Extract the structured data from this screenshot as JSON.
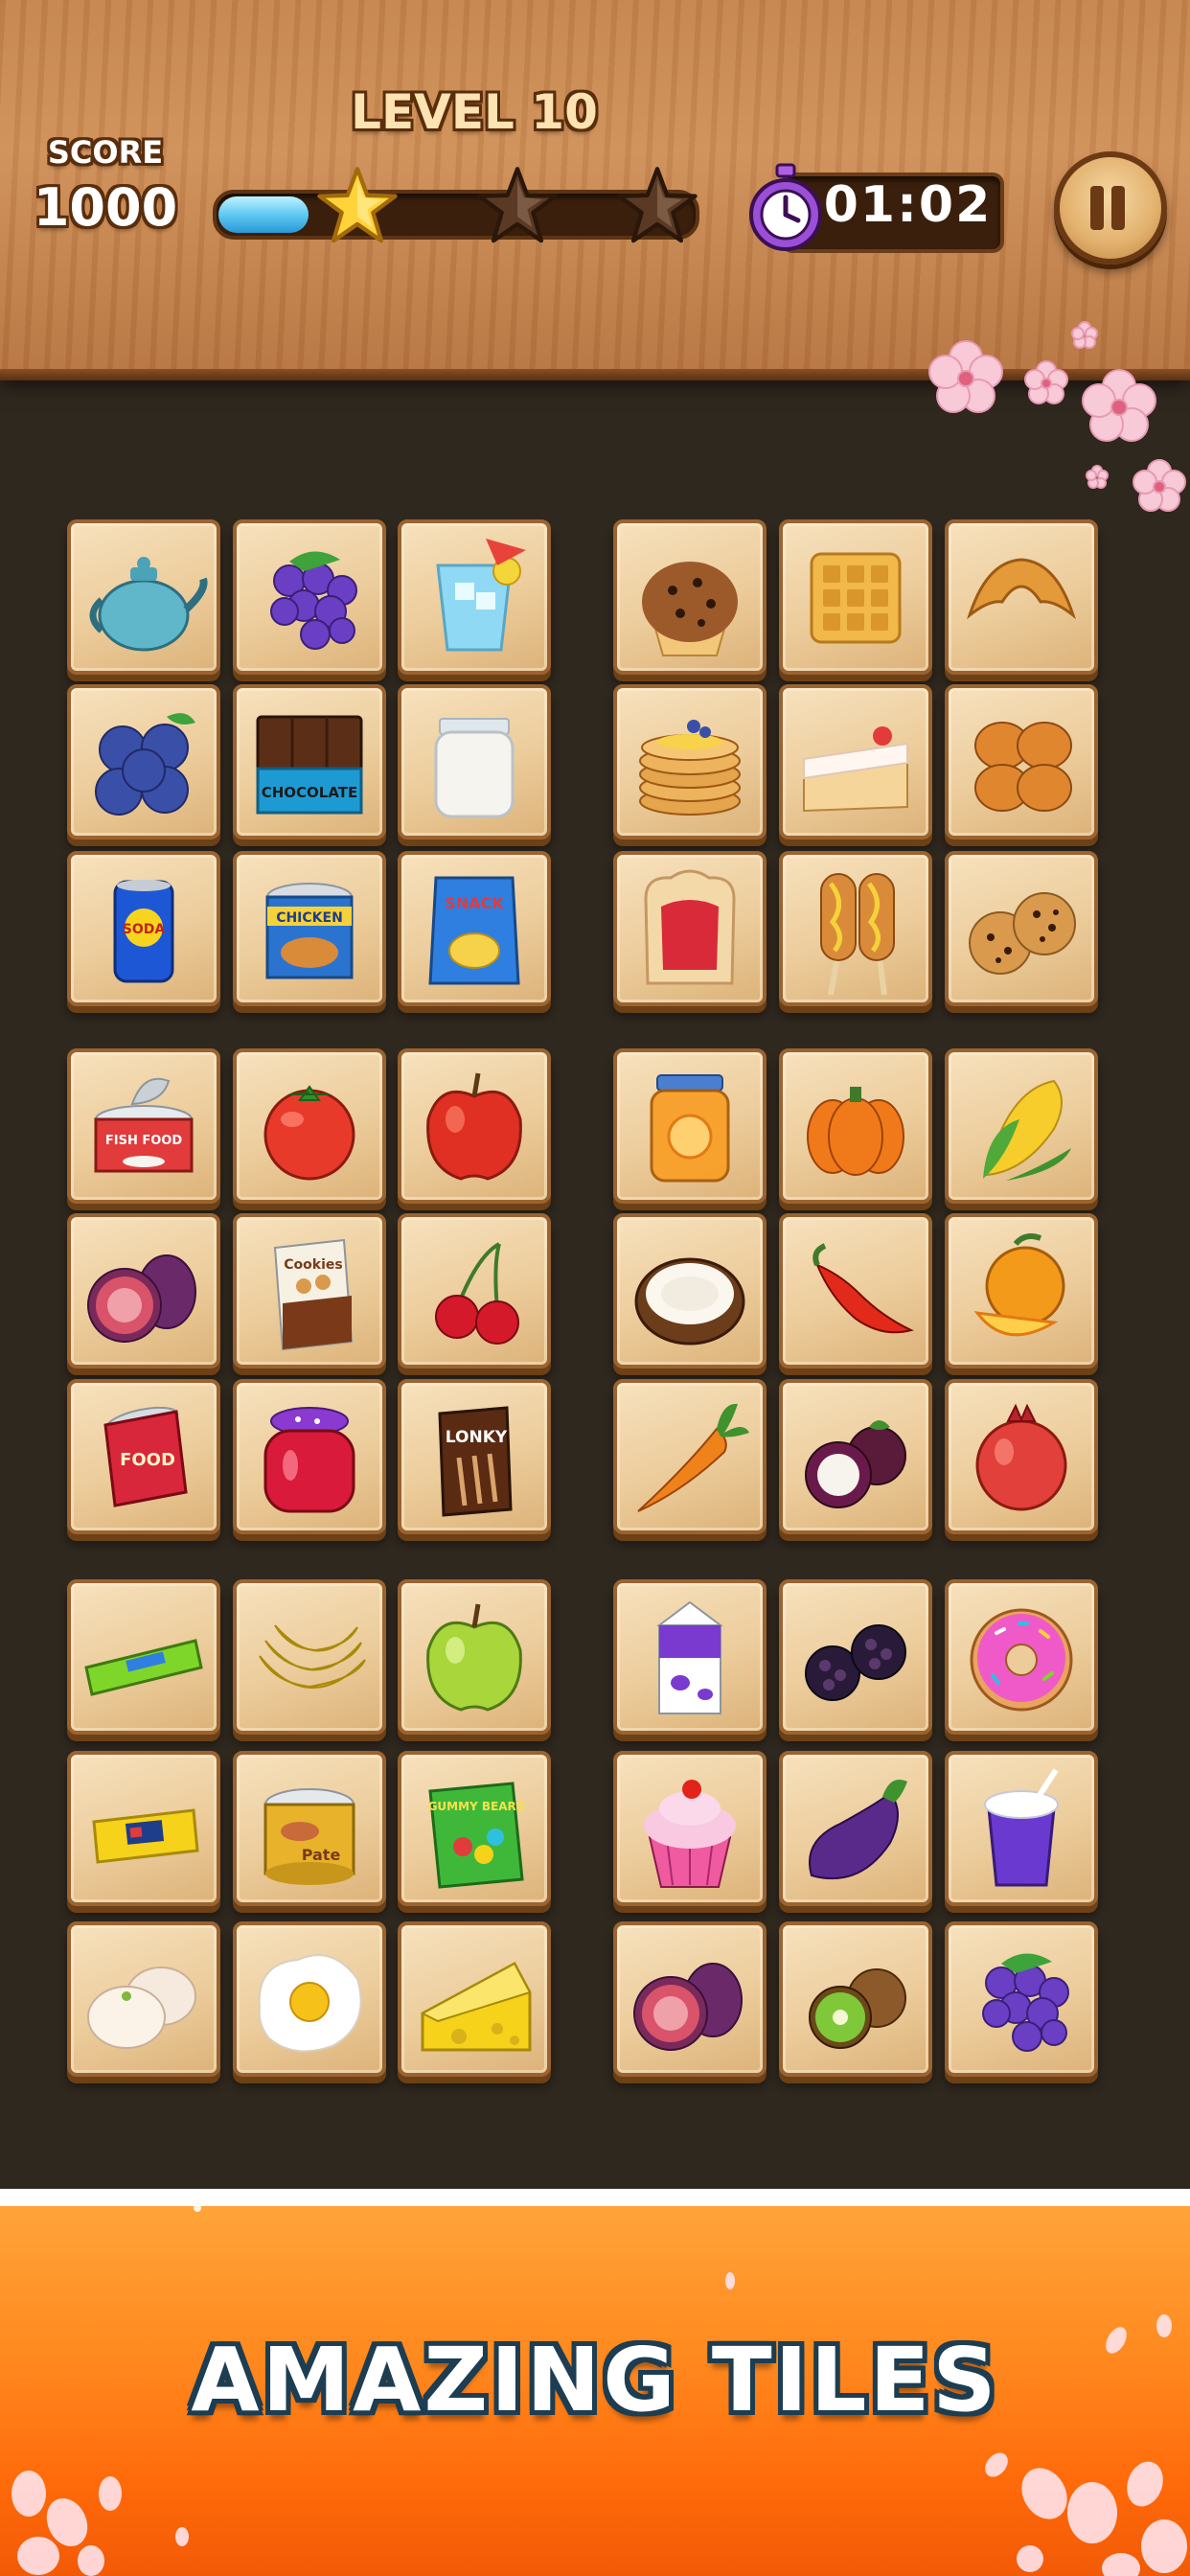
{
  "header": {
    "level_title": "LEVEL 10",
    "score_label": "SCORE",
    "score_value": "1000",
    "timer": "01:02",
    "progress_fraction": 0.19,
    "stars_earned": 1,
    "stars_total": 3
  },
  "buttons": {
    "pause_icon": "pause-icon"
  },
  "banner": {
    "text": "AMAZING TILES"
  },
  "tiles": [
    {
      "item": "teapot",
      "label": ""
    },
    {
      "item": "grapes",
      "label": ""
    },
    {
      "item": "iced-drink",
      "label": ""
    },
    {
      "item": "muffin",
      "label": ""
    },
    {
      "item": "waffle",
      "label": ""
    },
    {
      "item": "croissant",
      "label": ""
    },
    {
      "item": "blueberries",
      "label": ""
    },
    {
      "item": "chocolate",
      "label": "CHOCOLATE"
    },
    {
      "item": "milk-jar",
      "label": ""
    },
    {
      "item": "pancakes",
      "label": ""
    },
    {
      "item": "cake",
      "label": ""
    },
    {
      "item": "bread-rolls",
      "label": ""
    },
    {
      "item": "soda-can",
      "label": "SODA"
    },
    {
      "item": "chicken-can",
      "label": "CHICKEN"
    },
    {
      "item": "chips",
      "label": "SNACK"
    },
    {
      "item": "toast-jam",
      "label": ""
    },
    {
      "item": "corn-dogs",
      "label": ""
    },
    {
      "item": "cookies",
      "label": ""
    },
    {
      "item": "fish-can",
      "label": "FISH FOOD"
    },
    {
      "item": "tomato",
      "label": ""
    },
    {
      "item": "red-apple",
      "label": ""
    },
    {
      "item": "orange-jar",
      "label": ""
    },
    {
      "item": "pumpkin",
      "label": ""
    },
    {
      "item": "corn",
      "label": ""
    },
    {
      "item": "fig",
      "label": ""
    },
    {
      "item": "cookie-box",
      "label": "Cookies"
    },
    {
      "item": "cherries",
      "label": ""
    },
    {
      "item": "coconut",
      "label": ""
    },
    {
      "item": "chili",
      "label": ""
    },
    {
      "item": "orange",
      "label": ""
    },
    {
      "item": "food-can",
      "label": "FOOD"
    },
    {
      "item": "jam-jar",
      "label": ""
    },
    {
      "item": "choco-sticks",
      "label": "LONKY"
    },
    {
      "item": "carrot",
      "label": ""
    },
    {
      "item": "mangosteen",
      "label": ""
    },
    {
      "item": "pomegranate",
      "label": ""
    },
    {
      "item": "gum",
      "label": ""
    },
    {
      "item": "bananas",
      "label": ""
    },
    {
      "item": "green-apple",
      "label": ""
    },
    {
      "item": "milk-carton",
      "label": ""
    },
    {
      "item": "blackberries",
      "label": ""
    },
    {
      "item": "donut",
      "label": ""
    },
    {
      "item": "candy-bar",
      "label": ""
    },
    {
      "item": "pate-can",
      "label": "Pate"
    },
    {
      "item": "gummy-bears",
      "label": "GUMMY BEARS"
    },
    {
      "item": "cupcake",
      "label": ""
    },
    {
      "item": "eggplant",
      "label": ""
    },
    {
      "item": "milkshake",
      "label": ""
    },
    {
      "item": "dumplings",
      "label": ""
    },
    {
      "item": "fried-egg",
      "label": ""
    },
    {
      "item": "cheese",
      "label": ""
    },
    {
      "item": "fig",
      "label": ""
    },
    {
      "item": "kiwi",
      "label": ""
    },
    {
      "item": "grapes",
      "label": ""
    }
  ]
}
